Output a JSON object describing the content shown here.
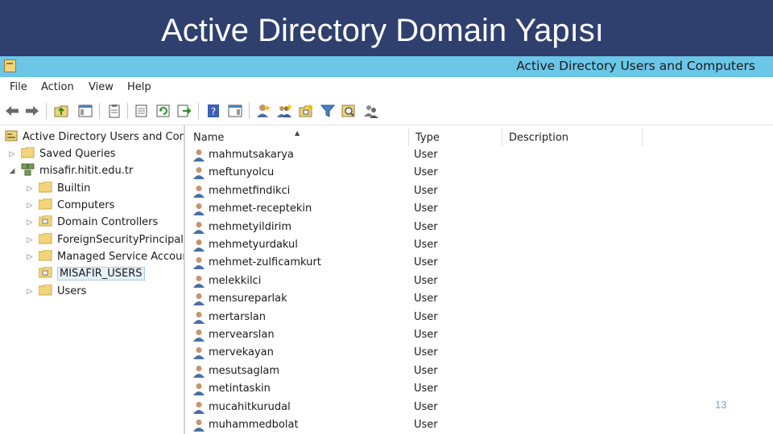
{
  "slide": {
    "title": "Active Directory Domain Yapısı",
    "page_number": "13"
  },
  "window": {
    "title": "Active Directory Users and Computers"
  },
  "menu": [
    "File",
    "Action",
    "View",
    "Help"
  ],
  "toolbar_icons": [
    "back-arrow-icon",
    "forward-arrow-icon",
    "up-folder-icon",
    "show-hide-console-tree-icon",
    "properties-icon",
    "export-list-icon",
    "refresh-icon",
    "export-icon",
    "help-icon",
    "show-hide-action-pane-icon",
    "new-user-icon",
    "new-group-icon",
    "new-ou-icon",
    "filter-icon",
    "find-icon",
    "add-to-group-icon"
  ],
  "tree": {
    "root": "Active Directory Users and Computers",
    "saved_queries": "Saved Queries",
    "domain": "misafir.hitit.edu.tr",
    "children": [
      "Builtin",
      "Computers",
      "Domain Controllers",
      "ForeignSecurityPrincipals",
      "Managed Service Accounts",
      "MISAFIR_USERS",
      "Users"
    ],
    "selected": "MISAFIR_USERS"
  },
  "list": {
    "columns": {
      "name": "Name",
      "type": "Type",
      "description": "Description"
    },
    "rows": [
      {
        "name": "mahmutsakarya",
        "type": "User"
      },
      {
        "name": "meftunyolcu",
        "type": "User"
      },
      {
        "name": "mehmetfindikci",
        "type": "User"
      },
      {
        "name": "mehmet-receptekin",
        "type": "User"
      },
      {
        "name": "mehmetyildirim",
        "type": "User"
      },
      {
        "name": "mehmetyurdakul",
        "type": "User"
      },
      {
        "name": "mehmet-zulficamkurt",
        "type": "User"
      },
      {
        "name": "melekkilci",
        "type": "User"
      },
      {
        "name": "mensureparlak",
        "type": "User"
      },
      {
        "name": "mertarslan",
        "type": "User"
      },
      {
        "name": "mervearslan",
        "type": "User"
      },
      {
        "name": "mervekayan",
        "type": "User"
      },
      {
        "name": "mesutsaglam",
        "type": "User"
      },
      {
        "name": "metintaskin",
        "type": "User"
      },
      {
        "name": "mucahitkurudal",
        "type": "User"
      },
      {
        "name": "muhammedbolat",
        "type": "User"
      }
    ]
  },
  "colors": {
    "slide_header": "#2f3f6e",
    "titlebar": "#6cc6e8",
    "folder": "#f2d579",
    "selection": "#e5f1fb",
    "page_number": "#7fa2c8"
  }
}
